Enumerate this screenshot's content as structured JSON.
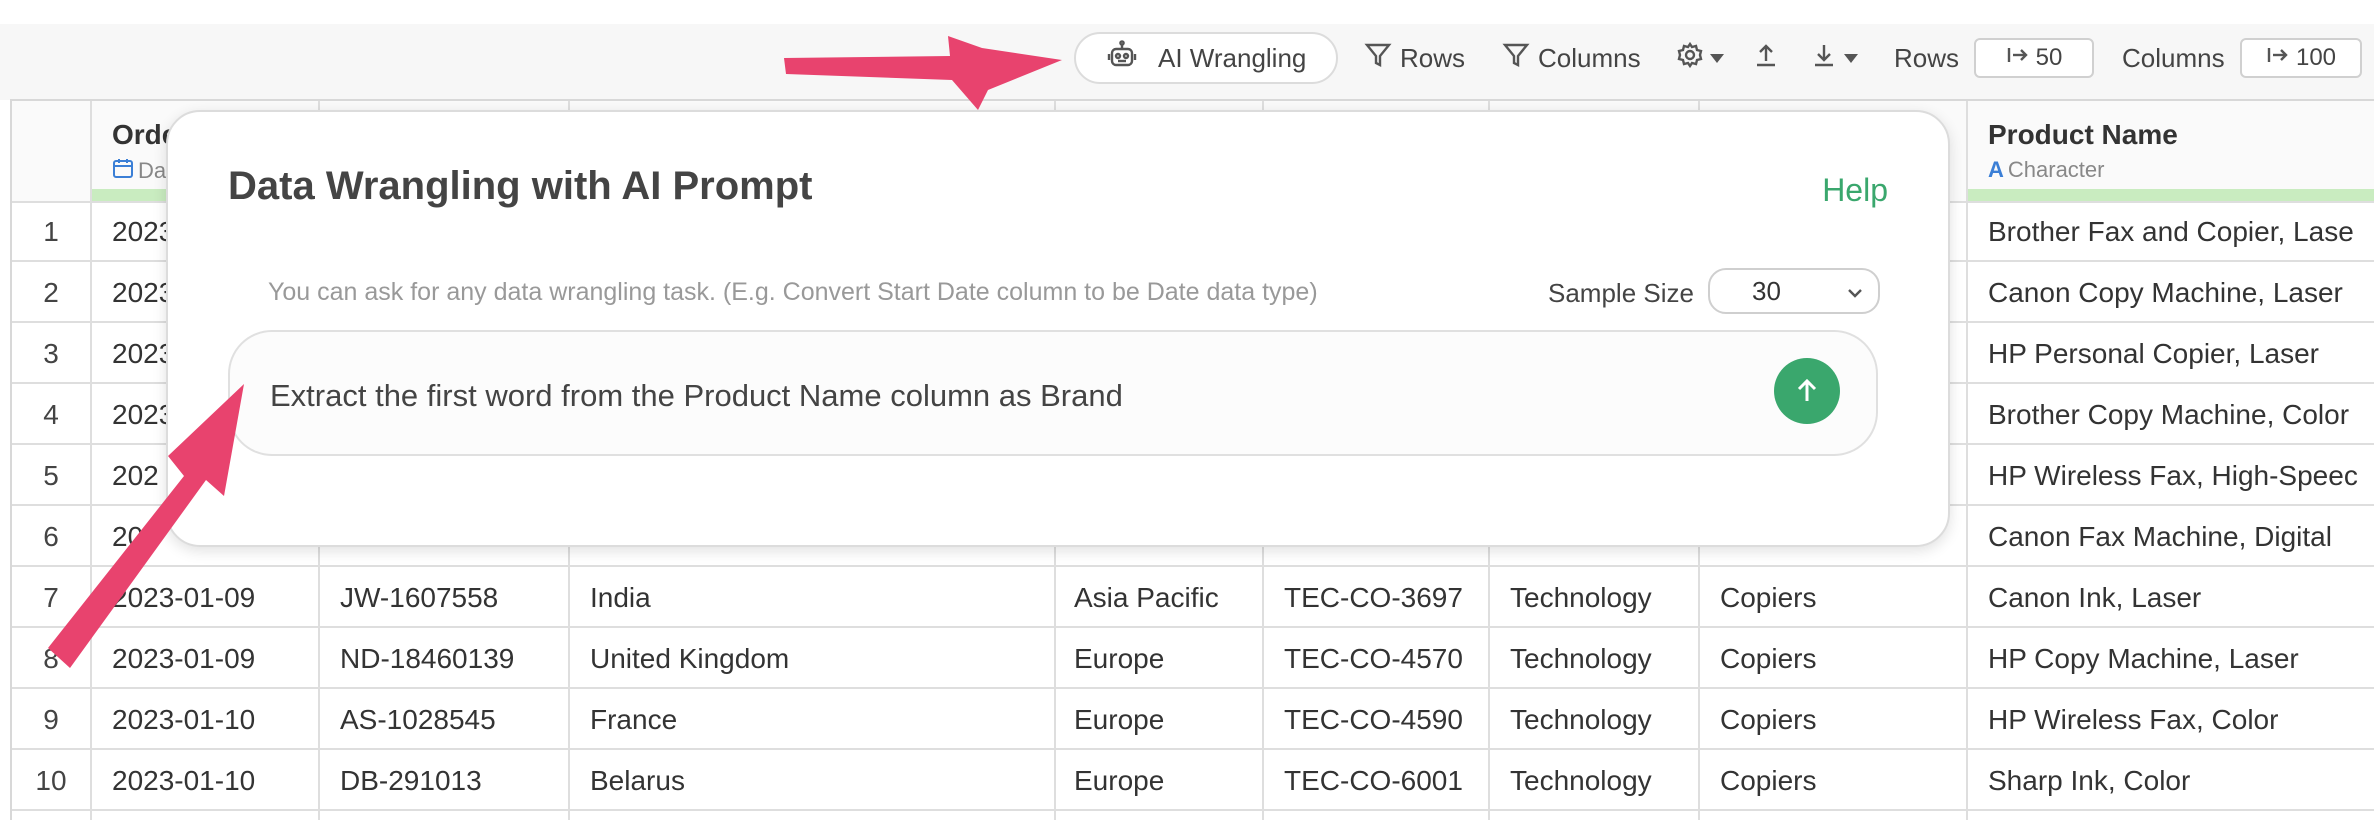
{
  "toolbar": {
    "ai_wrangling": "AI Wrangling",
    "rows_filter": "Rows",
    "columns_filter": "Columns",
    "rows_label": "Rows",
    "rows_value": "50",
    "columns_label": "Columns",
    "columns_value": "100",
    "icons": {
      "ai": "robot-icon",
      "filter": "filter-icon",
      "settings": "gear-icon",
      "upload": "upload-icon",
      "download": "download-icon",
      "pager": "arrow-right-bar-icon"
    }
  },
  "table": {
    "headers": [
      {
        "title": "Orde",
        "type": "Da"
      },
      {
        "title": "",
        "type": ""
      },
      {
        "title": "",
        "type": ""
      },
      {
        "title": "",
        "type": ""
      },
      {
        "title": "",
        "type": ""
      },
      {
        "title": "",
        "type": ""
      },
      {
        "title": "",
        "type": ""
      },
      {
        "title": "Product Name",
        "type": "Character"
      }
    ],
    "rows": [
      {
        "n": "1",
        "c": [
          "2023",
          "",
          "",
          "",
          "",
          "",
          "",
          "Brother Fax and Copier, Lase"
        ]
      },
      {
        "n": "2",
        "c": [
          "2023",
          "",
          "",
          "",
          "",
          "",
          "",
          "Canon Copy Machine, Laser"
        ]
      },
      {
        "n": "3",
        "c": [
          "2023",
          "",
          "",
          "",
          "",
          "",
          "",
          "HP Personal Copier, Laser"
        ]
      },
      {
        "n": "4",
        "c": [
          "2023",
          "",
          "",
          "",
          "",
          "",
          "",
          "Brother Copy Machine, Color"
        ]
      },
      {
        "n": "5",
        "c": [
          "202",
          "",
          "",
          "",
          "",
          "",
          "",
          "HP Wireless Fax, High-Speec"
        ]
      },
      {
        "n": "6",
        "c": [
          "20",
          "",
          "",
          "",
          "",
          "",
          "",
          "Canon Fax Machine, Digital"
        ]
      },
      {
        "n": "7",
        "c": [
          "2023-01-09",
          "JW-1607558",
          "India",
          "Asia Pacific",
          "TEC-CO-3697",
          "Technology",
          "Copiers",
          "Canon Ink, Laser"
        ]
      },
      {
        "n": "8",
        "c": [
          "2023-01-09",
          "ND-18460139",
          "United Kingdom",
          "Europe",
          "TEC-CO-4570",
          "Technology",
          "Copiers",
          "HP Copy Machine, Laser"
        ]
      },
      {
        "n": "9",
        "c": [
          "2023-01-10",
          "AS-1028545",
          "France",
          "Europe",
          "TEC-CO-4590",
          "Technology",
          "Copiers",
          "HP Wireless Fax, Color"
        ]
      },
      {
        "n": "10",
        "c": [
          "2023-01-10",
          "DB-291013",
          "Belarus",
          "Europe",
          "TEC-CO-6001",
          "Technology",
          "Copiers",
          "Sharp Ink, Color"
        ]
      }
    ]
  },
  "modal": {
    "title": "Data Wrangling with AI Prompt",
    "help": "Help",
    "hint": "You can ask for any data wrangling task. (E.g. Convert Start Date column to be Date data type)",
    "sample_size_label": "Sample Size",
    "sample_size_value": "30",
    "prompt": "Extract the first word from the Product Name column as Brand"
  },
  "colors": {
    "accent_green": "#3aa76d",
    "annotation_arrow": "#e8436e",
    "header_bar": "#c9ecc0"
  }
}
